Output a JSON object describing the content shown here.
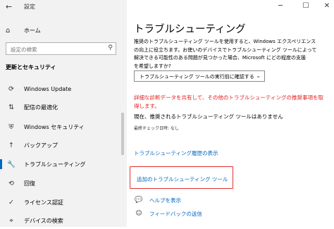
{
  "window": {
    "title": "設定",
    "back_icon": "←",
    "minimize_icon": "─",
    "maximize_icon": "☐",
    "close_icon": "✕"
  },
  "sidebar": {
    "home_label": "ホーム",
    "home_icon": "⌂",
    "search_placeholder": "設定の検索",
    "search_icon": "⚲",
    "section_title": "更新とセキュリティ",
    "items": [
      {
        "label": "Windows Update",
        "icon": "⟳",
        "active": false
      },
      {
        "label": "配信の最適化",
        "icon": "⇅",
        "active": false
      },
      {
        "label": "Windows セキュリティ",
        "icon": "⛨",
        "active": false
      },
      {
        "label": "バックアップ",
        "icon": "↑",
        "active": false
      },
      {
        "label": "トラブルシューティング",
        "icon": "🔧",
        "active": true
      },
      {
        "label": "回復",
        "icon": "⟲",
        "active": false
      },
      {
        "label": "ライセンス認証",
        "icon": "✓",
        "active": false
      },
      {
        "label": "デバイスの検索",
        "icon": "⌖",
        "active": false
      }
    ]
  },
  "main": {
    "title": "トラブルシューティング",
    "description_lines": [
      "推奨のトラブルシューティング ツールを使用すると、Windows エクスペリエンス",
      "の向上に役立ちます。お使いのデバイスでトラブルシューティング ツールによって",
      "解決できる可能性のある問題が見つかった場合、Microsoft にどの程度の支援",
      "を希望しますか?"
    ],
    "dropdown_value": "トラブルシューティング ツールの実行前に確認する",
    "dropdown_icon": "⌄",
    "warning_lines": [
      "詳細な診断データを共有して、その他のトラブルシューティングの推奨事項を取",
      "得します。"
    ],
    "status_text": "現在、推奨されるトラブルシューティング ツールはありません",
    "last_run": "最終チェック日時: なし",
    "history_link": "トラブルシューティング履歴の表示",
    "additional_link": "追加のトラブルシューティング ツール",
    "help_link": "ヘルプを表示",
    "help_icon": "💬",
    "feedback_link": "フィードバックの送信",
    "feedback_icon": "☺"
  },
  "colors": {
    "accent": "#0067c0",
    "warning": "#e01e1e",
    "highlight_border": "#e03030",
    "sidebar_bg": "#f2f2f2"
  }
}
